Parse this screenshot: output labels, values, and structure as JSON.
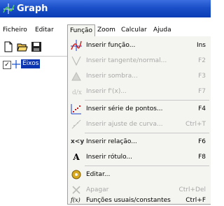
{
  "window": {
    "title": "Graph"
  },
  "menubar": {
    "items": [
      {
        "label": "Ficheiro"
      },
      {
        "label": "Editar"
      },
      {
        "label": "Função"
      },
      {
        "label": "Zoom"
      },
      {
        "label": "Calcular"
      },
      {
        "label": "Ajuda"
      }
    ],
    "active": "Função"
  },
  "tree": {
    "item": "Eixos",
    "checked": true
  },
  "function_menu": {
    "items": [
      {
        "label": "Inserir função...",
        "shortcut": "Ins",
        "enabled": true,
        "icon": "insert-function-icon"
      },
      {
        "label": "Inserir tangente/normal...",
        "shortcut": "F2",
        "enabled": false,
        "icon": "tangent-icon"
      },
      {
        "label": "Inserir sombra...",
        "shortcut": "F3",
        "enabled": false,
        "icon": "shade-icon"
      },
      {
        "label": "Inserir f'(x)...",
        "shortcut": "F7",
        "enabled": false,
        "icon": "derivative-icon"
      },
      {
        "label": "Inserir série de pontos...",
        "shortcut": "F4",
        "enabled": true,
        "icon": "point-series-icon"
      },
      {
        "label": "Inserir ajuste de curva...",
        "shortcut": "Ctrl+T",
        "enabled": false,
        "icon": "curve-fit-icon"
      },
      {
        "label": "Inserir relação...",
        "shortcut": "F6",
        "enabled": true,
        "icon": "relation-icon",
        "glyph": "x<y"
      },
      {
        "label": "Inserir rótulo...",
        "shortcut": "F8",
        "enabled": true,
        "icon": "label-icon",
        "glyph": "A"
      },
      {
        "label": "Editar...",
        "shortcut": "",
        "enabled": true,
        "icon": "edit-icon"
      },
      {
        "label": "Apagar",
        "shortcut": "Ctrl+Del",
        "enabled": false,
        "icon": "delete-icon"
      },
      {
        "label": "Funções usuais/constantes",
        "shortcut": "Ctrl+F",
        "enabled": true,
        "icon": "custom-functions-icon",
        "glyph": "f(x)"
      }
    ]
  }
}
